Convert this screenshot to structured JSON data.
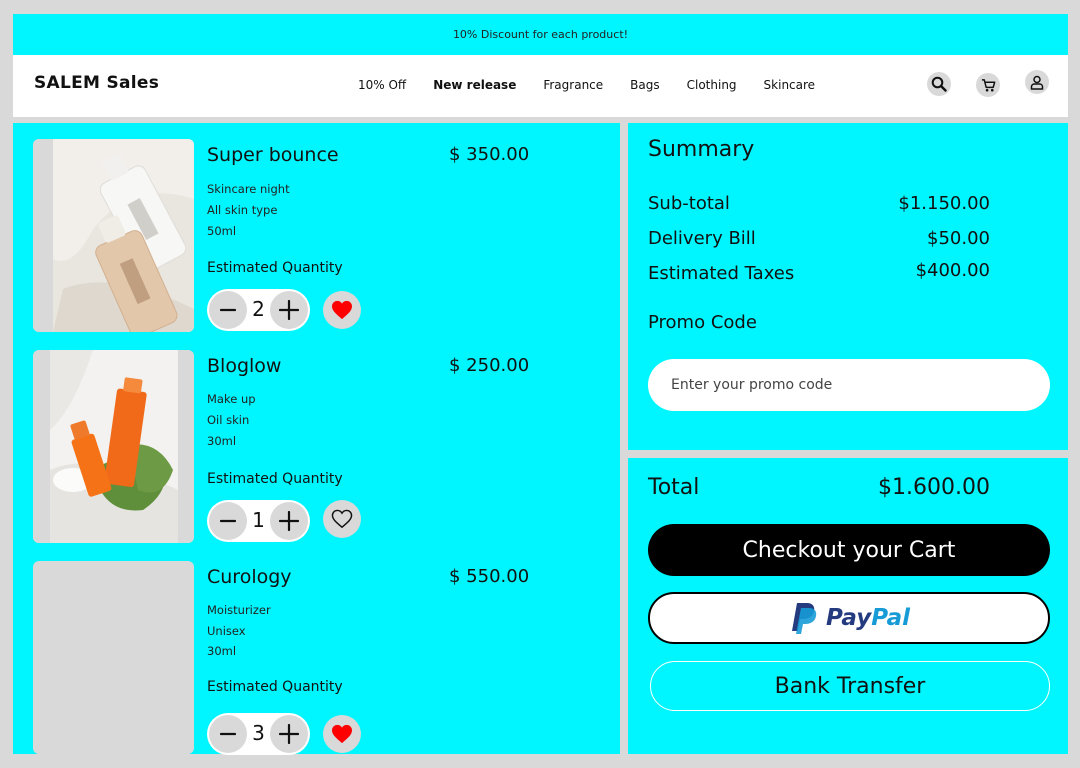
{
  "promo_bar": {
    "text": "10% Discount for each product!"
  },
  "header": {
    "brand": "SALEM Sales",
    "nav": [
      {
        "label": "10% Off"
      },
      {
        "label": "New release"
      },
      {
        "label": "Fragrance"
      },
      {
        "label": "Bags"
      },
      {
        "label": "Clothing"
      },
      {
        "label": "Skincare"
      }
    ],
    "icons": [
      "search-icon",
      "cart-icon",
      "user-icon"
    ]
  },
  "cart": {
    "quantity_label": "Estimated Quantity",
    "products": [
      {
        "name": "Super bounce",
        "price": "$ 350.00",
        "details": [
          "Skincare night",
          "All skin type",
          "50ml"
        ],
        "quantity": "2",
        "favorite": true
      },
      {
        "name": "Bloglow",
        "price": "$ 250.00",
        "details": [
          "Make up",
          "Oil skin",
          "30ml"
        ],
        "quantity": "1",
        "favorite": false
      },
      {
        "name": "Curology",
        "price": "$ 550.00",
        "details": [
          "Moisturizer",
          "Unisex",
          "30ml"
        ],
        "quantity": "3",
        "favorite": true
      }
    ]
  },
  "summary": {
    "title": "Summary",
    "rows": [
      {
        "label": "Sub-total",
        "value": "$1.150.00"
      },
      {
        "label": "Delivery Bill",
        "value": "$50.00"
      },
      {
        "label": "Estimated Taxes",
        "value": "$400.00"
      }
    ],
    "promo_label": "Promo Code",
    "promo_placeholder": "Enter your promo code"
  },
  "checkout": {
    "total_label": "Total",
    "total_value": "$1.600.00",
    "checkout_button": "Checkout your Cart",
    "paypal_pay": "Pay",
    "paypal_pal": "Pal",
    "bank_button": "Bank Transfer"
  },
  "colors": {
    "accent": "#00f6ff",
    "heart": "#ff0000",
    "paypal_dark": "#253b80",
    "paypal_light": "#179bd7"
  }
}
